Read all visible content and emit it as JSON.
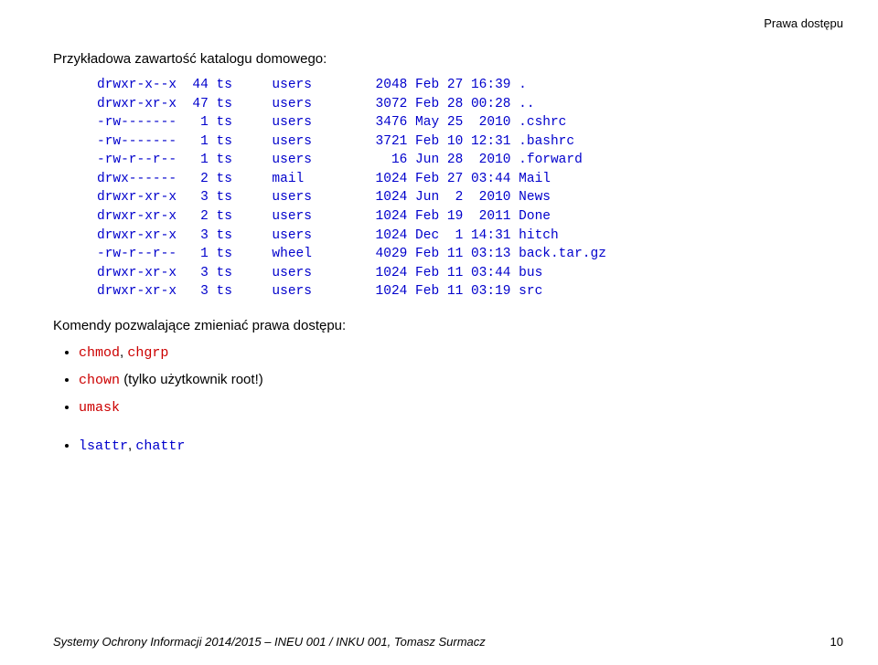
{
  "header": {
    "right": "Prawa dostępu"
  },
  "intro": "Przykładowa zawartość katalogu domowego:",
  "listing": "drwxr-x--x  44 ts     users        2048 Feb 27 16:39 .\ndrwxr-xr-x  47 ts     users        3072 Feb 28 00:28 ..\n-rw-------   1 ts     users        3476 May 25  2010 .cshrc\n-rw-------   1 ts     users        3721 Feb 10 12:31 .bashrc\n-rw-r--r--   1 ts     users          16 Jun 28  2010 .forward\ndrwx------   2 ts     mail         1024 Feb 27 03:44 Mail\ndrwxr-xr-x   3 ts     users        1024 Jun  2  2010 News\ndrwxr-xr-x   2 ts     users        1024 Feb 19  2011 Done\ndrwxr-xr-x   3 ts     users        1024 Dec  1 14:31 hitch\n-rw-r--r--   1 ts     wheel        4029 Feb 11 03:13 back.tar.gz\ndrwxr-xr-x   3 ts     users        1024 Feb 11 03:44 bus\ndrwxr-xr-x   3 ts     users        1024 Feb 11 03:19 src",
  "after": "Komendy pozwalające zmieniać prawa dostępu:",
  "bullets": {
    "b1a": "chmod",
    "b1b": "chgrp",
    "b2a": "chown",
    "b2b": "(tylko użytkownik root!)",
    "b3a": "umask",
    "b4a": "lsattr",
    "b4b": "chattr"
  },
  "footer": {
    "left": "Systemy Ochrony Informacji 2014/2015 – INEU 001 / INKU 001, Tomasz Surmacz",
    "right": "10"
  }
}
